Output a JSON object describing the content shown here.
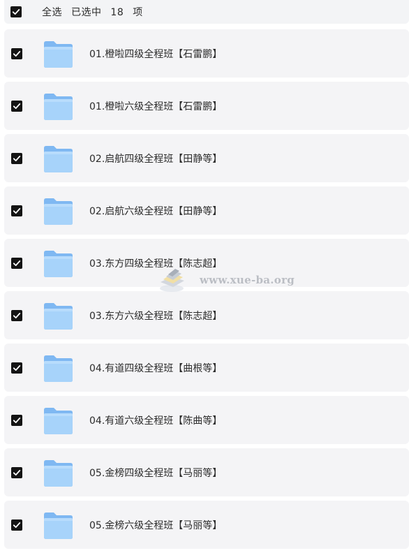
{
  "header": {
    "select_all": "全选",
    "selected_prefix": "已选中",
    "count": "18",
    "unit": "项"
  },
  "items": [
    {
      "name": "01.橙啦四级全程班【石雷鹏】",
      "checked": true
    },
    {
      "name": "01.橙啦六级全程班【石雷鹏】",
      "checked": true
    },
    {
      "name": "02.启航四级全程班【田静等】",
      "checked": true
    },
    {
      "name": "02.启航六级全程班【田静等】",
      "checked": true
    },
    {
      "name": "03.东方四级全程班【陈志超】",
      "checked": true
    },
    {
      "name": "03.东方六级全程班【陈志超】",
      "checked": true
    },
    {
      "name": "04.有道四级全程班【曲根等】",
      "checked": true
    },
    {
      "name": "04.有道六级全程班【陈曲等】",
      "checked": true
    },
    {
      "name": "05.金榜四级全程班【马丽等】",
      "checked": true
    },
    {
      "name": "05.金榜六级全程班【马丽等】",
      "checked": true
    }
  ],
  "watermark": {
    "text": "www.xue-ba.org"
  },
  "colors": {
    "row_bg": "#f4f4f6",
    "checkbox": "#141414",
    "folder": "#8cc3f6"
  }
}
